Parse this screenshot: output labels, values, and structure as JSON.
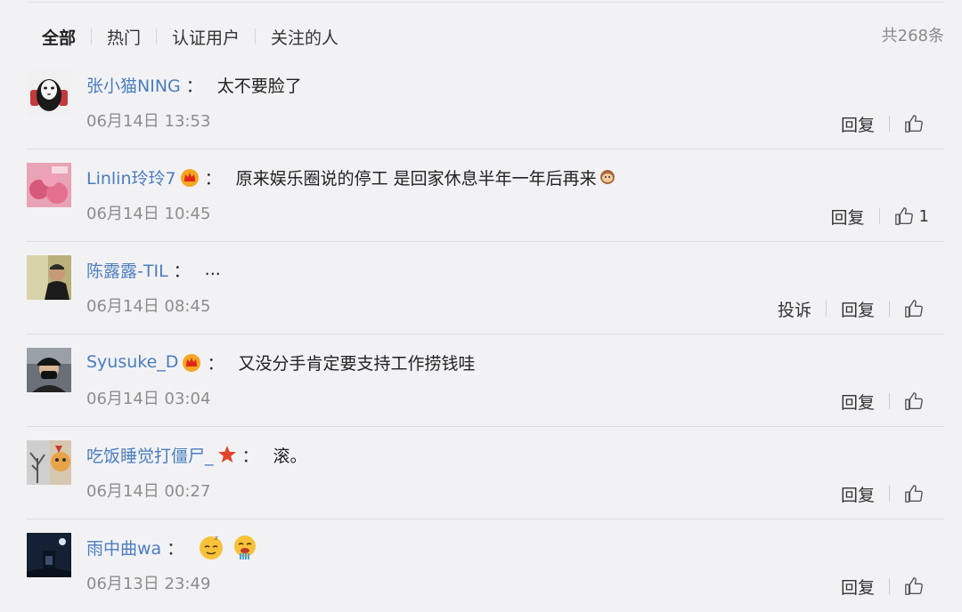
{
  "tabs": [
    {
      "label": "全部",
      "active": true
    },
    {
      "label": "热门",
      "active": false
    },
    {
      "label": "认证用户",
      "active": false
    },
    {
      "label": "关注的人",
      "active": false
    }
  ],
  "total": "共268条",
  "actions": {
    "reply": "回复",
    "report": "投诉"
  },
  "comments": [
    {
      "user": "张小猫NING",
      "colon": "：",
      "text": "太不要脸了",
      "time": "06月14日 13:53",
      "likes": ""
    },
    {
      "user": "Linlin玲玲7",
      "colon": "：",
      "text": "原来娱乐圈说的停工 是回家休息半年一年后再来",
      "time": "06月14日 10:45",
      "likes": "1"
    },
    {
      "user": "陈露露-TIL",
      "colon": "：",
      "text": "...",
      "time": "06月14日 08:45",
      "likes": ""
    },
    {
      "user": "Syusuke_D",
      "colon": "：",
      "text": "又没分手肯定要支持工作捞钱哇",
      "time": "06月14日 03:04",
      "likes": ""
    },
    {
      "user": "吃饭睡觉打僵尸_",
      "colon": "：",
      "text": "滚。",
      "time": "06月14日 00:27",
      "likes": ""
    },
    {
      "user": "雨中曲wa",
      "colon": "：",
      "text": "",
      "time": "06月13日 23:49",
      "likes": ""
    }
  ],
  "icons": {
    "like": "thumbs-up-icon",
    "vip_badge": "crown-vip-icon",
    "star_badge": "red-star-icon",
    "monkey_emoji": "monkey-emoji-icon",
    "sleepy_emoji": "sleepy-emoji-icon",
    "drool_emoji": "drool-emoji-icon"
  },
  "colors": {
    "link": "#4a7dbf",
    "background": "#f2f2f5",
    "time": "#8d8d8d"
  }
}
